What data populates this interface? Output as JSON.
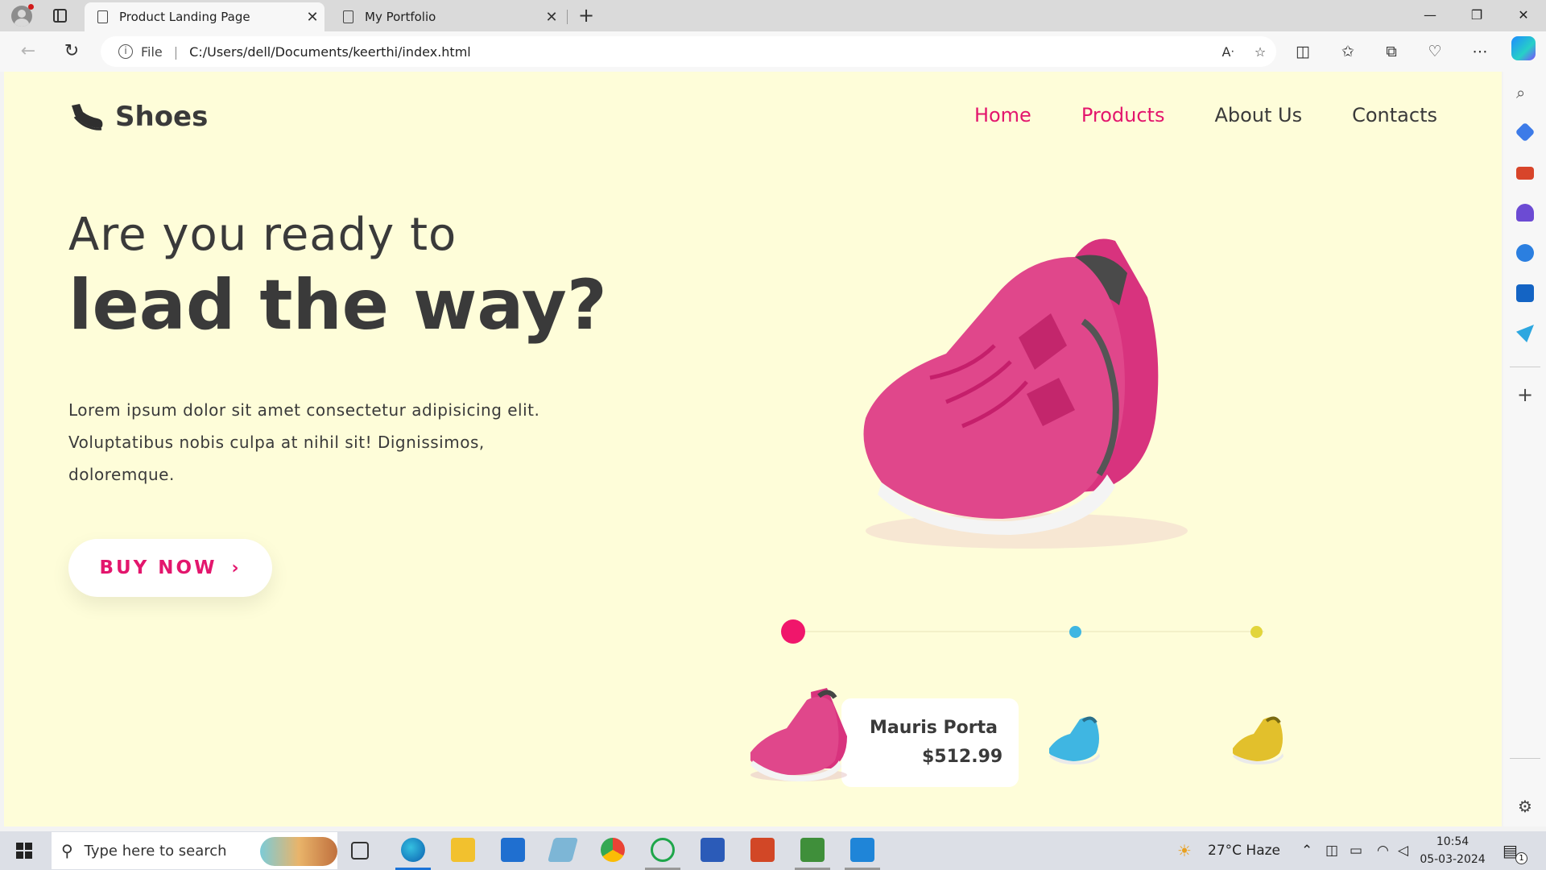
{
  "browser": {
    "tabs": [
      {
        "title": "Product Landing Page",
        "active": true
      },
      {
        "title": "My Portfolio",
        "active": false
      }
    ],
    "address": {
      "scheme_label": "File",
      "url": "C:/Users/dell/Documents/keerthi/index.html"
    }
  },
  "site": {
    "brand": "Shoes",
    "nav": [
      "Home",
      "Products",
      "About Us",
      "Contacts"
    ],
    "headline_small": "Are you ready to",
    "headline_big": "lead the way?",
    "paragraph": "Lorem ipsum dolor sit amet consectetur adipisicing elit. Voluptatibus nobis culpa at nihil sit! Dignissimos, doloremque.",
    "cta": "BUY NOW",
    "product": {
      "name": "Mauris Porta",
      "price": "$512.99"
    },
    "colors": {
      "accent": "#e3166d",
      "background": "#fefdd9",
      "dot_pink": "#f0166b",
      "dot_blue": "#3fb6e2",
      "dot_yellow": "#e2d53c"
    }
  },
  "taskbar": {
    "search_placeholder": "Type here to search",
    "weather": "27°C  Haze",
    "time": "10:54",
    "date": "05-03-2024",
    "notification_count": "1"
  }
}
